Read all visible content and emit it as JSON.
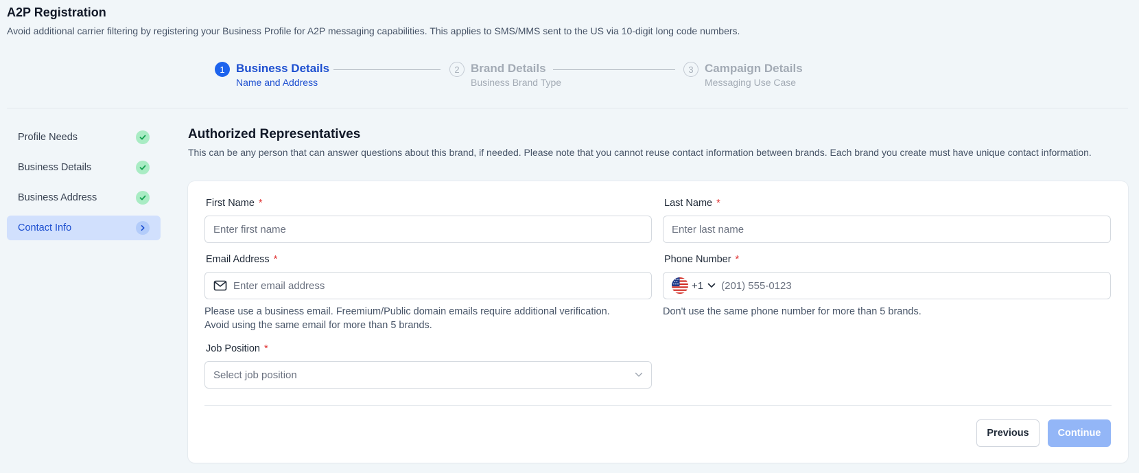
{
  "header": {
    "title": "A2P Registration",
    "subtitle": "Avoid additional carrier filtering by registering your Business Profile for A2P messaging capabilities. This applies to SMS/MMS sent to the US via 10-digit long code numbers."
  },
  "stepper": {
    "steps": [
      {
        "number": "1",
        "title": "Business Details",
        "description": "Name and Address",
        "state": "active"
      },
      {
        "number": "2",
        "title": "Brand Details",
        "description": "Business Brand Type",
        "state": "inactive"
      },
      {
        "number": "3",
        "title": "Campaign Details",
        "description": "Messaging Use Case",
        "state": "inactive"
      }
    ]
  },
  "sidebar": {
    "items": [
      {
        "label": "Profile Needs",
        "status": "complete"
      },
      {
        "label": "Business Details",
        "status": "complete"
      },
      {
        "label": "Business Address",
        "status": "complete"
      },
      {
        "label": "Contact Info",
        "status": "current"
      }
    ]
  },
  "section": {
    "title": "Authorized Representatives",
    "description": "This can be any person that can answer questions about this brand, if needed. Please note that you cannot reuse contact information between brands. Each brand you create must have unique contact information."
  },
  "form": {
    "required_mark": "*",
    "first_name": {
      "label": "First Name",
      "placeholder": "Enter first name",
      "value": ""
    },
    "last_name": {
      "label": "Last Name",
      "placeholder": "Enter last name",
      "value": ""
    },
    "email": {
      "label": "Email Address",
      "placeholder": "Enter email address",
      "value": "",
      "icon": "mail-icon",
      "hint": "Please use a business email. Freemium/Public domain emails require additional verification. Avoid using the same email for more than 5 brands."
    },
    "phone": {
      "label": "Phone Number",
      "country_code": "+1",
      "country_icon": "us-flag-icon",
      "placeholder": "(201) 555-0123",
      "value": "",
      "hint": "Don't use the same phone number for more than 5 brands."
    },
    "job_position": {
      "label": "Job Position",
      "selected": "Select job position"
    }
  },
  "actions": {
    "previous_label": "Previous",
    "continue_label": "Continue"
  },
  "colors": {
    "primary": "#1d63ed",
    "success_bg": "#a9ecc4",
    "success_check": "#12a150",
    "required": "#e03131",
    "continue_disabled": "#93b6f7"
  }
}
